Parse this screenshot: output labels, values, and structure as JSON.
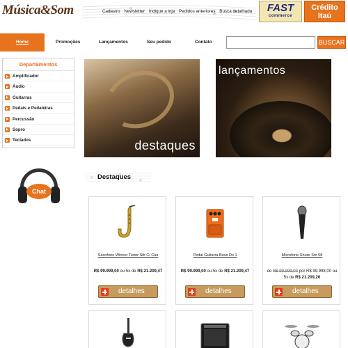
{
  "header": {
    "logo": "Música&Som",
    "top_links": [
      "Cadastro",
      "Newsletter",
      "Indique a loja",
      "Pedidos anteriores",
      "Busca detalhada"
    ],
    "badge_fast": {
      "line1": "FAST",
      "line2": "commerce"
    },
    "badge_itau": {
      "line1": "Crédito",
      "line2": "Itaú"
    }
  },
  "nav": {
    "items": [
      "Home",
      "Promoções",
      "Lançamentos",
      "Seu pedido",
      "Contato"
    ],
    "search_value": "",
    "search_button": "BUSCAR"
  },
  "sidebar": {
    "title": "Departamentos",
    "items": [
      "Amplificador",
      "Áudio",
      "Guitarras",
      "Pedais e Pedaleiras",
      "Percussão",
      "Sopro",
      "Teclados"
    ]
  },
  "banners": {
    "left": "destaques",
    "right": "lançamentos"
  },
  "chat": {
    "label": "Chat"
  },
  "section": {
    "title": "Destaques"
  },
  "products": [
    {
      "name": "Saxofone Winner Tenor Sib C/ Cas",
      "price_prefix": "",
      "old_price": "",
      "price": "R$ 99.999,00",
      "installments_text": "ou 5x de",
      "installment": "R$ 21.209,47",
      "button": "detalhes",
      "icon": "saxophone-icon"
    },
    {
      "name": "Pedal Guitarra Boss Ds 1",
      "price_prefix": "",
      "old_price": "",
      "price": "R$ 99.999,00",
      "installments_text": "ou 5x de",
      "installment": "R$ 21.209,47",
      "button": "detalhes",
      "icon": "guitar-pedal-icon"
    },
    {
      "name": "Microfone Shure Sm 58",
      "price_prefix": "de",
      "old_price": "R$ 99.999,00",
      "price_mid": "por",
      "price": "R$ 99.998,00",
      "installments_text": "ou",
      "installments_count": "5x de",
      "installment": "R$ 21.209,26",
      "button": "detalhes",
      "icon": "microphone-icon"
    }
  ],
  "products_row2_icons": [
    "electric-guitar-icon",
    "amplifier-icon",
    "drum-kit-icon"
  ],
  "colors": {
    "accent": "#e8731f",
    "button": "#c79a5e",
    "logo": "#5a3519"
  }
}
